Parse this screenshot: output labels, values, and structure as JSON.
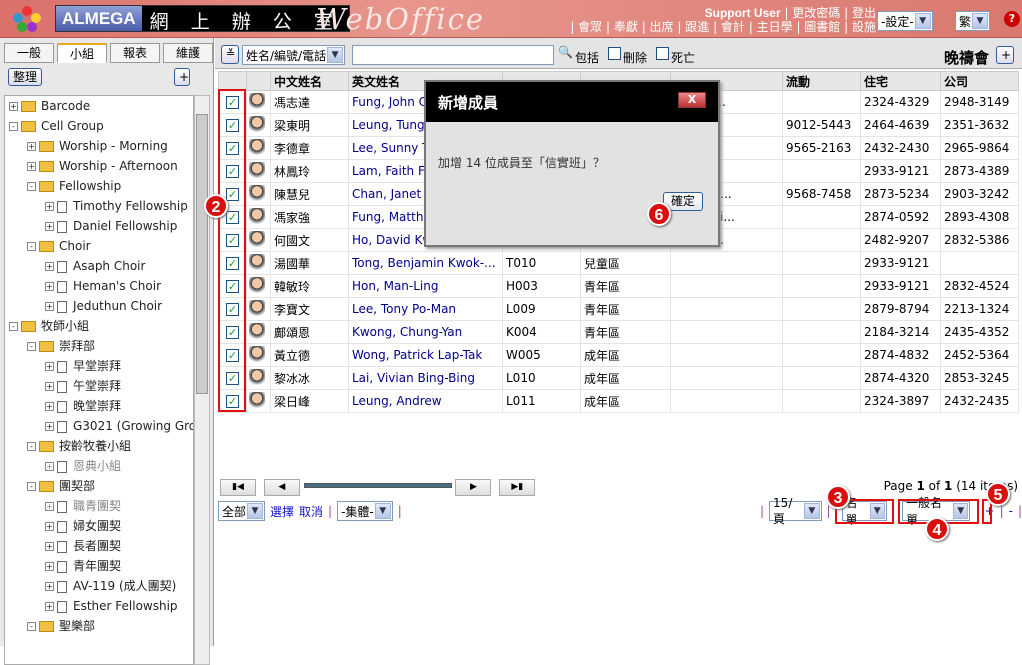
{
  "header": {
    "brand_en": "ALMEGA",
    "brand_zh": "網 上 辦 公 室",
    "product": "WebOffice",
    "user": "Support User",
    "links_top": [
      "更改密碼",
      "登出"
    ],
    "links_bottom": [
      "會眾",
      "奉獻",
      "出席",
      "跟進",
      "會計",
      "主日學",
      "圖書館",
      "設施"
    ],
    "settings_select": "-設定-",
    "lang_select": "繁",
    "help": "?"
  },
  "sidebar": {
    "tabs": [
      "一般",
      "小組",
      "報表",
      "維護"
    ],
    "active_tab": 1,
    "organize": "整理",
    "add": "+",
    "tree": [
      {
        "label": "Barcode",
        "level": 0,
        "type": "folder",
        "pm": "+"
      },
      {
        "label": "Cell Group",
        "level": 0,
        "type": "folder",
        "pm": "-"
      },
      {
        "label": "Worship - Morning",
        "level": 1,
        "type": "folder",
        "pm": "+"
      },
      {
        "label": "Worship - Afternoon",
        "level": 1,
        "type": "folder",
        "pm": "+"
      },
      {
        "label": "Fellowship",
        "level": 1,
        "type": "folder",
        "pm": "-"
      },
      {
        "label": "Timothy Fellowship",
        "level": 2,
        "type": "doc",
        "pm": "+"
      },
      {
        "label": "Daniel Fellowship",
        "level": 2,
        "type": "doc",
        "pm": "+"
      },
      {
        "label": "Choir",
        "level": 1,
        "type": "folder",
        "pm": "-"
      },
      {
        "label": "Asaph Choir",
        "level": 2,
        "type": "doc",
        "pm": "+"
      },
      {
        "label": "Heman's Choir",
        "level": 2,
        "type": "doc",
        "pm": "+"
      },
      {
        "label": "Jeduthun Choir",
        "level": 2,
        "type": "doc",
        "pm": "+"
      },
      {
        "label": "牧師小組",
        "level": 0,
        "type": "folder",
        "pm": "-"
      },
      {
        "label": "崇拜部",
        "level": 1,
        "type": "folder",
        "pm": "-"
      },
      {
        "label": "早堂崇拜",
        "level": 2,
        "type": "doc",
        "pm": "+"
      },
      {
        "label": "午堂崇拜",
        "level": 2,
        "type": "doc",
        "pm": "+"
      },
      {
        "label": "晚堂崇拜",
        "level": 2,
        "type": "doc",
        "pm": "+"
      },
      {
        "label": "G3021 (Growing Gro",
        "level": 2,
        "type": "doc",
        "pm": "+"
      },
      {
        "label": "按齡牧養小組",
        "level": 1,
        "type": "folder",
        "pm": "-"
      },
      {
        "label": "恩典小組",
        "level": 2,
        "type": "doc",
        "pm": "+",
        "dim": true
      },
      {
        "label": "團契部",
        "level": 1,
        "type": "folder",
        "pm": "-"
      },
      {
        "label": "職青團契",
        "level": 2,
        "type": "doc",
        "pm": "+",
        "dim": true
      },
      {
        "label": "婦女團契",
        "level": 2,
        "type": "doc",
        "pm": "+"
      },
      {
        "label": "長者團契",
        "level": 2,
        "type": "doc",
        "pm": "+"
      },
      {
        "label": "青年團契",
        "level": 2,
        "type": "doc",
        "pm": "+"
      },
      {
        "label": "AV-119 (成人團契)",
        "level": 2,
        "type": "doc",
        "pm": "+"
      },
      {
        "label": "Esther Fellowship",
        "level": 2,
        "type": "doc",
        "pm": "+"
      },
      {
        "label": "聖樂部",
        "level": 1,
        "type": "folder",
        "pm": "-"
      }
    ]
  },
  "toolbar": {
    "search_field": "姓名/編號/電話",
    "search_value": "",
    "include": "包括",
    "deleted": "刪除",
    "deceased": "死亡",
    "group_title": "晚禱會",
    "add": "+"
  },
  "table": {
    "headers": [
      "",
      "",
      "中文姓名",
      "英文姓名",
      "",
      "",
      "",
      "流動",
      "住宅",
      "公司"
    ],
    "rows": [
      [
        "馮志達",
        "Fung, John C",
        "",
        "",
        "main.c...",
        "",
        "2324-4329",
        "2948-3149"
      ],
      [
        "梁東明",
        "Leung, Tung",
        "",
        "",
        "",
        "9012-5443",
        "2464-4639",
        "2351-3632"
      ],
      [
        "李德章",
        "Lee, Sunny T",
        "",
        "",
        "",
        "9565-2163",
        "2432-2430",
        "2965-9864"
      ],
      [
        "林鳳玲",
        "Lam, Faith Fu",
        "",
        "",
        "",
        "",
        "2933-9121",
        "2873-4389"
      ],
      [
        "陳慧兒",
        "Chan, Janet",
        "",
        "",
        "n@dom...",
        "9568-7458",
        "2873-5234",
        "2903-3242"
      ],
      [
        "馮家強",
        "Fung, Matthe",
        "",
        "",
        "@domai...",
        "",
        "2874-0592",
        "2893-4308"
      ],
      [
        "何國文",
        "Ho, David Kw",
        "",
        "",
        "@dom...",
        "",
        "2482-9207",
        "2832-5386"
      ],
      [
        "湯國華",
        "Tong, Benjamin Kwok-...",
        "T010",
        "兒童區",
        "",
        "",
        "2933-9121",
        ""
      ],
      [
        "韓敏玲",
        "Hon, Man-Ling",
        "H003",
        "青年區",
        "",
        "",
        "2933-9121",
        "2832-4524"
      ],
      [
        "李寶文",
        "Lee, Tony Po-Man",
        "L009",
        "青年區",
        "",
        "",
        "2879-8794",
        "2213-1324"
      ],
      [
        "鄺頌恩",
        "Kwong, Chung-Yan",
        "K004",
        "青年區",
        "",
        "",
        "2184-3214",
        "2435-4352"
      ],
      [
        "黃立德",
        "Wong, Patrick Lap-Tak",
        "W005",
        "成年區",
        "",
        "",
        "2874-4832",
        "2452-5364"
      ],
      [
        "黎冰冰",
        "Lai, Vivian Bing-Bing",
        "L010",
        "成年區",
        "",
        "",
        "2874-4320",
        "2853-3245"
      ],
      [
        "梁日峰",
        "Leung, Andrew",
        "L011",
        "成年區",
        "",
        "",
        "2324-3897",
        "2432-2435"
      ]
    ]
  },
  "pager": {
    "page_text_pre": "Page ",
    "page": "1",
    "of": " of ",
    "total": "1",
    "count": " (14 items)"
  },
  "bottom": {
    "scope": "全部",
    "select": "選擇",
    "cancel": "取消",
    "group_select": "-集體-",
    "per_page": "15/頁",
    "list_select": "名單",
    "list_type": "一般名單",
    "plus": "+",
    "minus": "-"
  },
  "dialog": {
    "title": "新增成員",
    "close": "X",
    "message": "加增 14 位成員至「信實班」？",
    "ok": "確定"
  },
  "badges": [
    "2",
    "3",
    "4",
    "5",
    "6"
  ],
  "colors": {
    "header": "#e0827a",
    "highlight": "#e01010",
    "link": "#1616c8"
  }
}
